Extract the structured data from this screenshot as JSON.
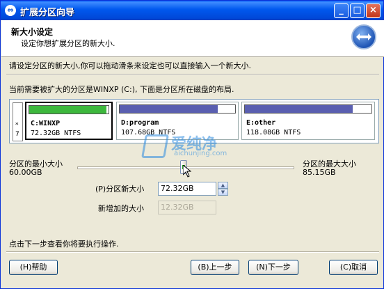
{
  "window": {
    "title": "扩展分区向导",
    "title_icon": "wizard-icon"
  },
  "header": {
    "title": "新大小设定",
    "subtitle": "设定你想扩展分区的新大小."
  },
  "main": {
    "instruction": "请设定分区的新大小,你可以拖动滑条来设定也可以直接输入一个新大小.",
    "current_partition_note": "当前需要被扩大的分区是WINXP (C:), 下面是分区所在磁盘的布局."
  },
  "disk": {
    "info_symbol": "*",
    "info_number": "7",
    "partitions": [
      {
        "name": "C:WINXP",
        "size": "72.32GB NTFS",
        "used_fraction": 0.97,
        "color": "#3DB83D",
        "selected": true
      },
      {
        "name": "D:program",
        "size": "107.68GB NTFS",
        "used_fraction": 0.85,
        "color": "#5A5FB0",
        "selected": false
      },
      {
        "name": "E:other",
        "size": "118.08GB NTFS",
        "used_fraction": 0.85,
        "color": "#5A5FB0",
        "selected": false
      }
    ]
  },
  "slider": {
    "min_label": "分区的最小大小",
    "min_value": "60.00GB",
    "max_label": "分区的最大大小",
    "max_value": "85.15GB",
    "position_fraction": 0.49
  },
  "new_size": {
    "label": "(P)分区新大小",
    "value": "72.32GB"
  },
  "added_size": {
    "label": "新增加的大小",
    "value": "12.32GB"
  },
  "footer_note": "点击下一步查看你将要执行操作.",
  "buttons": {
    "help": "(H)帮助",
    "back": "(B)上一步",
    "next": "(N)下一步",
    "cancel": "(C)取消"
  },
  "watermark": {
    "brand": "爱纯净",
    "url": "aichunjing.com"
  },
  "colors": {
    "titlebar": "#0058EE",
    "used_green": "#3DB83D",
    "used_blue": "#5A5FB0"
  }
}
